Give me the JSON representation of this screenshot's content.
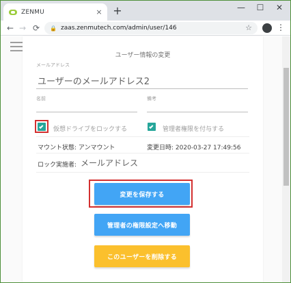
{
  "browser": {
    "tab_title": "ZENMU",
    "tab_close": "×",
    "new_tab": "+",
    "url": "zaas.zenmutech.com/admin/user/146",
    "controls": {
      "minimize": "—",
      "maximize": "☐",
      "close": "✕"
    },
    "nav": {
      "back": "←",
      "forward": "→",
      "reload": "⟳"
    },
    "star": "☆",
    "menu": "⋮"
  },
  "form": {
    "title": "ユーザー情報の変更",
    "email": {
      "label": "メールアドレス",
      "value": "ユーザーのメールアドレス2"
    },
    "name": {
      "label": "名前",
      "value": ""
    },
    "note": {
      "label": "備考",
      "value": ""
    },
    "lock_drive": {
      "label": "仮想ドライブをロックする",
      "checked": true
    },
    "admin_grant": {
      "label": "管理者権限を付与する",
      "checked": true
    },
    "mount_status": "マウント状態: アンマウント",
    "modified": "変更日時: 2020-03-27 17:49:56",
    "locker_label": "ロック実施者:",
    "locker_value": "メールアドレス"
  },
  "buttons": {
    "save": "変更を保存する",
    "admin_settings": "管理者の権限設定へ移動",
    "delete": "このユーザーを削除する"
  },
  "colors": {
    "save": "#42a5f5",
    "admin_settings": "#42a5f5",
    "delete": "#fbc02d",
    "checkbox": "#26a69a",
    "highlight": "#d32f2f"
  }
}
